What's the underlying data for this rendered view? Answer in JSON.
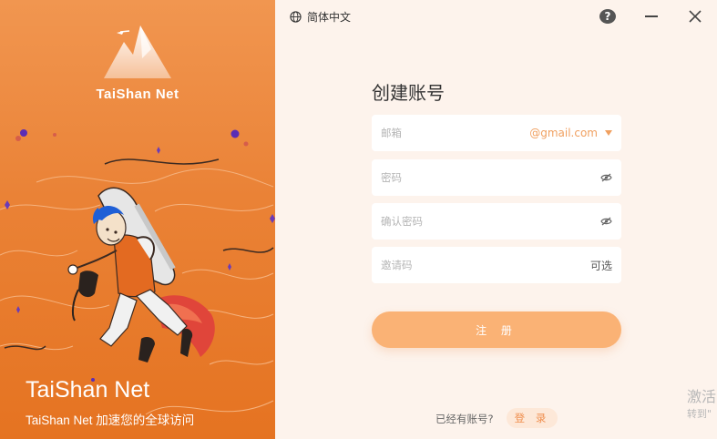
{
  "brand": {
    "logo_text": "TaiShan Net",
    "hero_title": "TaiShan Net",
    "hero_subtitle": "TaiShan Net 加速您的全球访问"
  },
  "topbar": {
    "language": "简体中文",
    "help_glyph": "?"
  },
  "form": {
    "title": "创建账号",
    "email_placeholder": "邮箱",
    "email_domain": "@gmail.com",
    "password_placeholder": "密码",
    "confirm_placeholder": "确认密码",
    "invite_placeholder": "邀请码",
    "invite_optional": "可选",
    "submit_label": "注 册"
  },
  "footer": {
    "have_account": "已经有账号?",
    "login_label": "登 录"
  },
  "watermark": {
    "line1": "激活",
    "line2": "转到\""
  },
  "colors": {
    "accent": "#fab275",
    "brand_orange": "#ea8236",
    "link": "#f0a060"
  }
}
